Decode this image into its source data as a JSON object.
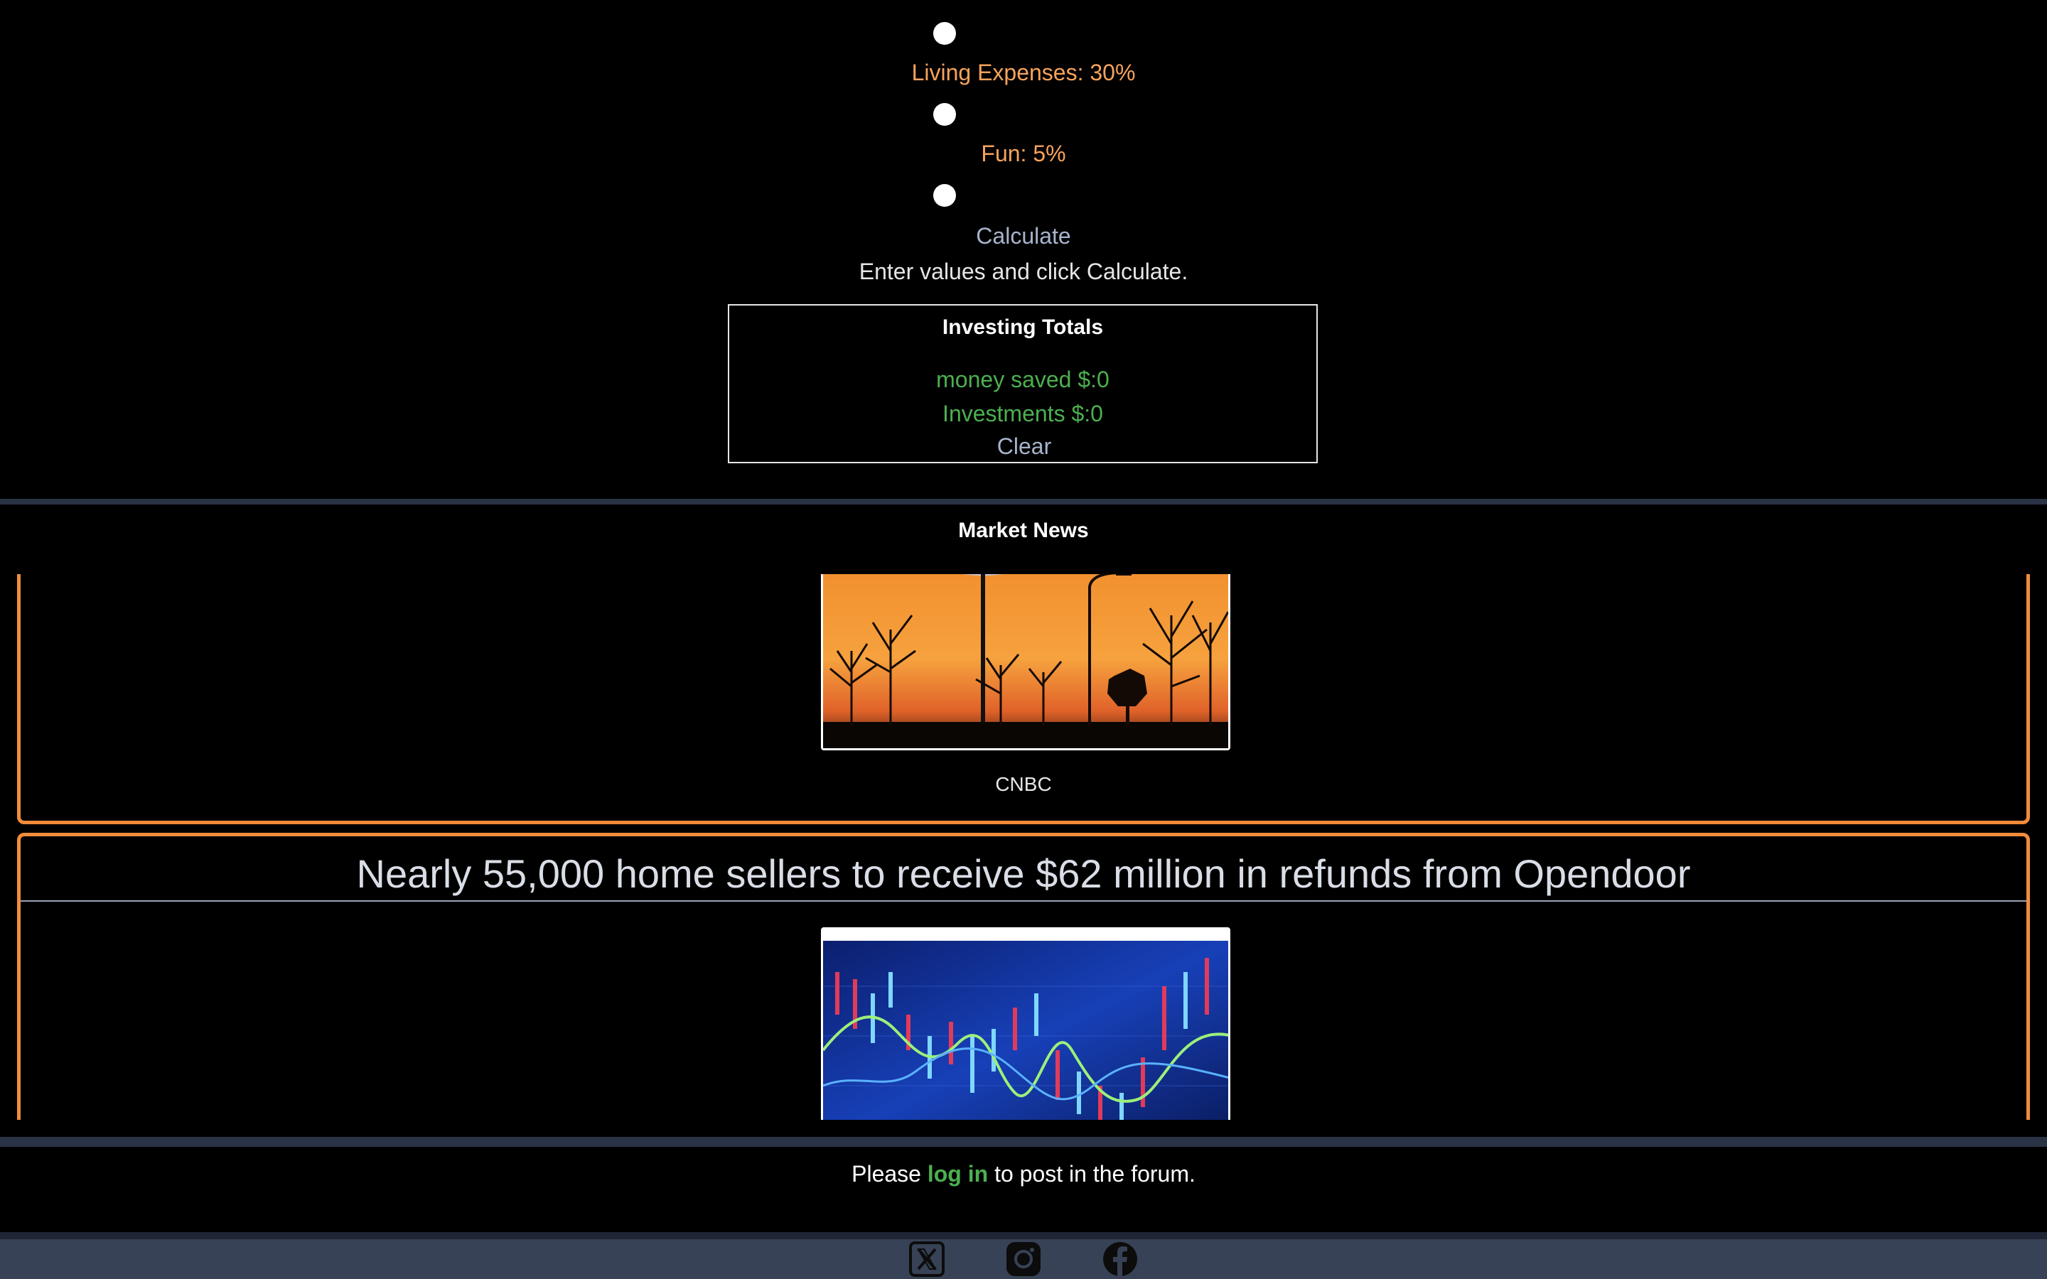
{
  "budget": {
    "sliders": [
      {
        "label": "Living Expenses: 30%",
        "value": 30
      },
      {
        "label": "Fun: 5%",
        "value": 5
      }
    ],
    "calculate_label": "Calculate",
    "instructions": "Enter values and click Calculate."
  },
  "totals": {
    "title": "Investing Totals",
    "money_saved": "money saved $:0",
    "investments": "Investments $:0",
    "clear_label": "Clear"
  },
  "news": {
    "heading": "Market News",
    "articles": [
      {
        "source": "CNBC",
        "image": "ford-dealership-sunset-photo"
      },
      {
        "title": "Nearly 55,000 home sellers to receive $62 million in refunds from Opendoor",
        "image": "stock-market-candlestick-chart-photo"
      }
    ]
  },
  "forum": {
    "prefix": "Please ",
    "link": "log in",
    "suffix": " to post in the forum."
  },
  "footer": {
    "icons": [
      "x-twitter-icon",
      "instagram-icon",
      "facebook-icon"
    ]
  },
  "colors": {
    "accent_orange": "#f28c3b",
    "label_orange": "#f7a35c",
    "green": "#4caf50",
    "footer_bg": "#384256",
    "divider": "#2a3346"
  }
}
